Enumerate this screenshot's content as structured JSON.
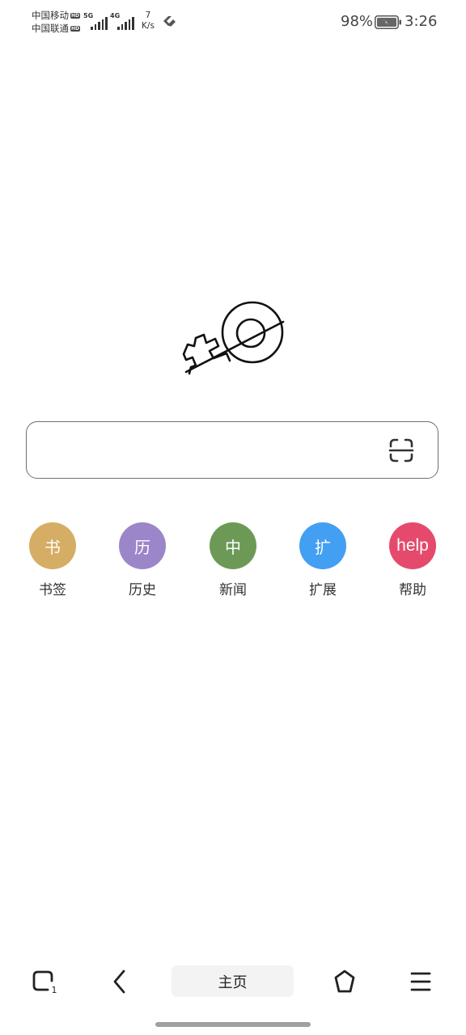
{
  "status_bar": {
    "carrier_1": "中国移动",
    "carrier_2": "中国联通",
    "hd_badge": "HD",
    "signal_1_gen": "5G",
    "signal_2_gen": "4G",
    "net_speed_value": "7",
    "net_speed_unit": "K/s",
    "battery_percent": "98%",
    "time": "3:26",
    "icons": [
      "signal-icon",
      "link-icon",
      "battery-charging-icon"
    ]
  },
  "logo": {
    "icon": "via-logo-icon"
  },
  "search": {
    "value": "",
    "placeholder": "",
    "scan_icon": "scan-icon"
  },
  "shortcuts": [
    {
      "icon_text": "书",
      "label": "书签",
      "color": "#d5ad64"
    },
    {
      "icon_text": "历",
      "label": "历史",
      "color": "#9b86c9"
    },
    {
      "icon_text": "中",
      "label": "新闻",
      "color": "#6c9a56"
    },
    {
      "icon_text": "扩",
      "label": "扩展",
      "color": "#439ff1"
    },
    {
      "icon_text": "help",
      "label": "帮助",
      "color": "#e54a6d"
    }
  ],
  "bottom_nav": {
    "tabs_count": "1",
    "home_label": "主页",
    "icons": [
      "tabs-icon",
      "back-icon",
      "home-icon",
      "menu-icon"
    ]
  }
}
